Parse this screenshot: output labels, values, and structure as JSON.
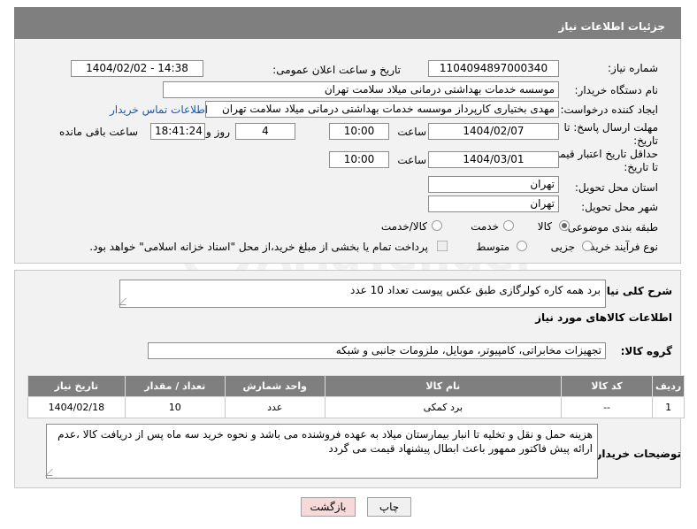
{
  "header": {
    "title": "جزئیات اطلاعات نیاز"
  },
  "fields": {
    "need_number_label": "شماره نیاز:",
    "need_number": "1104094897000340",
    "announce_label": "تاریخ و ساعت اعلان عمومی:",
    "announce_value": "1404/02/02 - 14:38",
    "buyer_org_label": "نام دستگاه خریدار:",
    "buyer_org": "موسسه خدمات بهداشتی درمانی میلاد سلامت تهران",
    "creator_label": "ایجاد کننده درخواست:",
    "creator": "مهدی بختیاری کارپرداز موسسه خدمات بهداشتی درمانی میلاد سلامت تهران",
    "contact_link": "اطلاعات تماس خریدار",
    "reply_deadline_label_1": "مهلت ارسال پاسخ: تا",
    "reply_deadline_label_2": "تاریخ:",
    "reply_date": "1404/02/07",
    "time_label": "ساعت",
    "reply_time": "10:00",
    "days_value": "4",
    "days_label": "روز و",
    "remaining_time": "18:41:24",
    "remaining_label": "ساعت باقی مانده",
    "price_validity_label_1": "حداقل تاریخ اعتبار قیمت:",
    "price_validity_label_2": "تا تاریخ:",
    "price_date": "1404/03/01",
    "price_time": "10:00",
    "province_label": "استان محل تحویل:",
    "province": "تهران",
    "city_label": "شهر محل تحویل:",
    "city": "تهران",
    "category_label": "طبقه بندی موضوعی:",
    "category_options": [
      "کالا",
      "خدمت",
      "کالا/خدمت"
    ],
    "process_label": "نوع فرآیند خرید :",
    "process_options": [
      "جزیی",
      "متوسط"
    ],
    "payment_note": "پرداخت تمام یا بخشی از مبلغ خرید،از محل \"اسناد خزانه اسلامی\" خواهد بود."
  },
  "description": {
    "label": "شرح کلی نیاز:",
    "text": "برد همه کاره کولرگازی طبق عکس پیوست تعداد 10 عدد"
  },
  "goods": {
    "section_title": "اطلاعات کالاهای مورد نیاز",
    "group_label": "گروه کالا:",
    "group_value": "تجهیزات مخابراتی، کامپیوتر، موبایل، ملزومات جانبی و شبکه",
    "columns": [
      "ردیف",
      "کد کالا",
      "نام کالا",
      "واحد شمارش",
      "تعداد / مقدار",
      "تاریخ نیاز"
    ],
    "rows": [
      [
        "1",
        "--",
        "برد کمکی",
        "عدد",
        "10",
        "1404/02/18"
      ]
    ]
  },
  "buyer_notes": {
    "label": "توضیحات خریدار:",
    "text": "هزینه حمل و نقل و تخلیه تا انبار بیمارستان میلاد به عهده فروشنده می باشد و نحوه خرید سه ماه پس از دریافت کالا ،عدم ارائه پیش فاکتور ممهور باعث ابطال پیشنهاد قیمت می گردد"
  },
  "buttons": {
    "print": "چاپ",
    "back": "بازگشت"
  },
  "colors": {
    "header_bg": "#7f7f7f",
    "panel_bg": "#f2f2f2",
    "link": "#1a5ba8",
    "back_btn_bg": "#f7d9d9"
  }
}
